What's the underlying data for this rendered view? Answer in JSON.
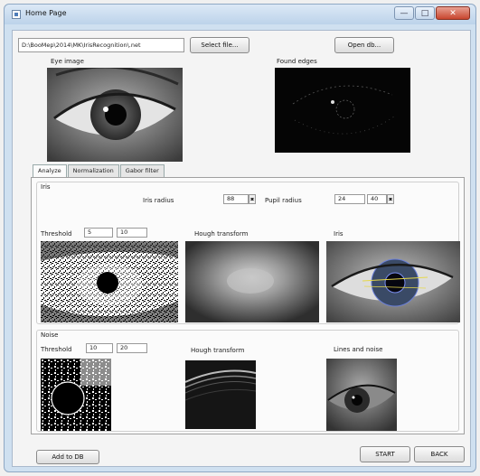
{
  "window": {
    "title": "Home Page",
    "minimize_glyph": "—",
    "maximize_glyph": "□",
    "close_glyph": "✕"
  },
  "file": {
    "path": "D:\\BooMep\\2014\\MK\\IrisRecognition\\.net",
    "select_button": "Select file...",
    "open_db_button": "Open db..."
  },
  "images": {
    "eye_label": "Eye image",
    "edges_label": "Found edges"
  },
  "tabs": [
    "Analyze",
    "Normalization",
    "Gabor filter"
  ],
  "iris": {
    "group_label": "Iris",
    "iris_radius_label": "Iris radius",
    "iris_radius_value": "88",
    "pupil_radius_label": "Pupil radius",
    "pupil_radius_min": "24",
    "pupil_radius_max": "40",
    "threshold_label": "Threshold",
    "threshold_min": "5",
    "threshold_max": "10",
    "hough_label": "Hough transform",
    "result_label": "Iris"
  },
  "noise": {
    "group_label": "Noise",
    "threshold_label": "Threshold",
    "threshold_min": "10",
    "threshold_max": "20",
    "hough_label": "Hough transform",
    "result_label": "Lines and noise"
  },
  "actions": {
    "add_to_db": "Add to DB",
    "start": "START",
    "back": "BACK"
  }
}
